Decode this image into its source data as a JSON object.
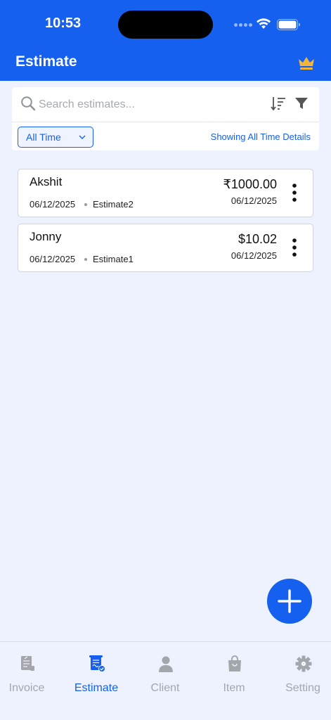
{
  "status_bar": {
    "time": "10:53"
  },
  "header": {
    "title": "Estimate",
    "crown_icon": "crown-icon",
    "crown_color": "#F2B53A"
  },
  "search": {
    "placeholder": "Search estimates...",
    "value": ""
  },
  "filter": {
    "selected": "All Time",
    "showing": "Showing All Time Details"
  },
  "estimates": [
    {
      "name": "Akshit",
      "date": "06/12/2025",
      "number": "Estimate2",
      "amount": "₹1000.00",
      "due_date": "06/12/2025"
    },
    {
      "name": "Jonny",
      "date": "06/12/2025",
      "number": "Estimate1",
      "amount": "$10.02",
      "due_date": "06/12/2025"
    }
  ],
  "tabs": [
    {
      "label": "Invoice",
      "icon": "invoice-icon"
    },
    {
      "label": "Estimate",
      "icon": "estimate-icon",
      "active": true
    },
    {
      "label": "Client",
      "icon": "client-icon"
    },
    {
      "label": "Item",
      "icon": "item-bag-icon"
    },
    {
      "label": "Setting",
      "icon": "gear-icon"
    }
  ],
  "colors": {
    "primary": "#1560EE",
    "background": "#EDF2FE",
    "inactive": "#A3A6AB"
  }
}
